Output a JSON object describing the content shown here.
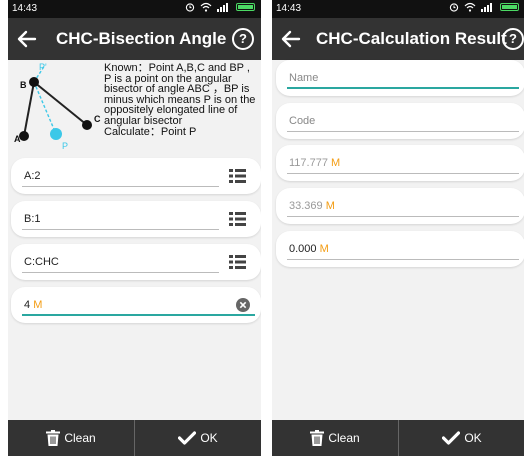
{
  "status_bar": {
    "time": "14:43"
  },
  "screens": {
    "bisection": {
      "title": "CHC-Bisection Angle",
      "help_label": "?",
      "diagram_labels": {
        "p_prime": "P'",
        "b": "B",
        "c": "C",
        "a": "A",
        "p": "P"
      },
      "known_text": "Known：Point A,B,C and BP , P is a point on the angular bisector of angle ABC ，BP is minus which means P is on the oppositely elongated line of angular bisector",
      "calculate_text": "Calculate：Point P",
      "fields": {
        "a": "A:2",
        "b": "B:1",
        "c": "C:CHC",
        "bp_value": "4",
        "bp_unit": "M"
      }
    },
    "result": {
      "title": "CHC-Calculation Result",
      "help_label": "?",
      "name_placeholder": "Name",
      "code_placeholder": "Code",
      "north_value": "117.777",
      "east_value": "33.369",
      "height_value": "0.000",
      "unit": "M"
    }
  },
  "bottom_bar": {
    "clean_label": "Clean",
    "ok_label": "OK"
  },
  "colors": {
    "app_bar": "#333333",
    "accent_unit": "#f39c12",
    "active_underline": "#2aa7a0",
    "diagram_cyan": "#3cc8e8",
    "battery": "#4cd964"
  },
  "icons": [
    "back-arrow-icon",
    "help-icon",
    "list-icon",
    "clear-icon",
    "trash-icon",
    "check-icon",
    "wifi-icon",
    "signal-icon",
    "alarm-icon",
    "battery-icon"
  ]
}
